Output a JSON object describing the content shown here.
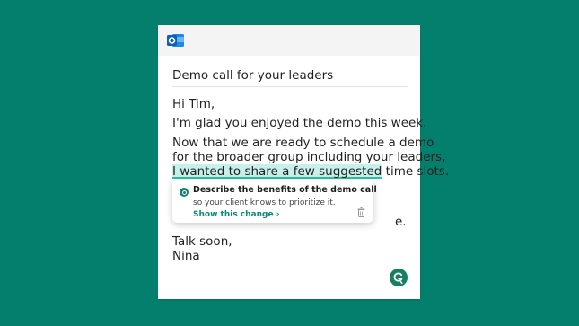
{
  "email": {
    "app_icon": "outlook-icon",
    "subject": "Demo call for your leaders",
    "greeting": "Hi Tim,",
    "line1": "I'm glad you enjoyed the demo this week.",
    "line2": "Now that we are ready to schedule a demo",
    "line3": "for the broader group including your leaders,",
    "highlighted_text": "I wanted to share a few suggested",
    "line4_rest": " time slots.",
    "partial_line_end": "e.",
    "signoff": "Talk soon,",
    "signature": "Nina"
  },
  "suggestion": {
    "icon": "grammarly-icon",
    "title": "Describe the benefits of the demo call",
    "body": "so your client knows to prioritize it.",
    "link": "Show this change ›",
    "dismiss_icon": "trash-icon"
  },
  "grammarly_button": {
    "icon": "grammarly-icon"
  },
  "colors": {
    "background": "#047f6d",
    "accent": "#0d8a76",
    "highlight": "#c8f0ea"
  }
}
